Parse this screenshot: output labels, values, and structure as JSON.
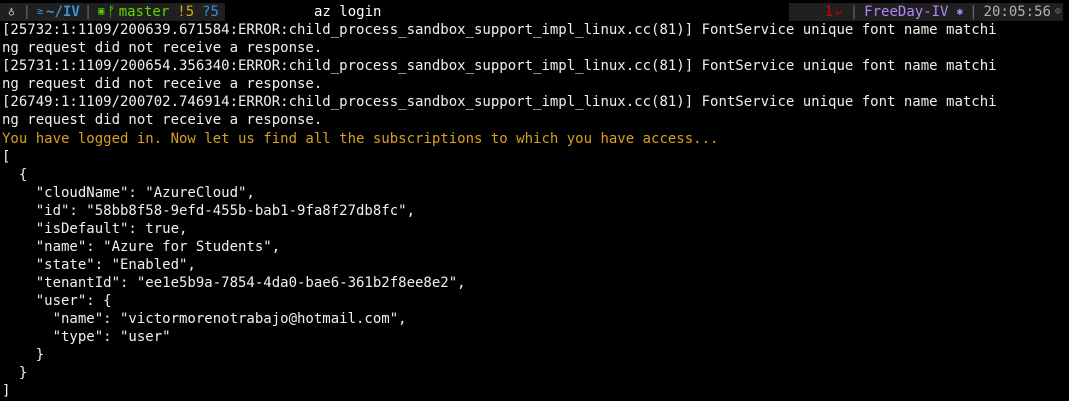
{
  "prompt": {
    "os_icon": "♁",
    "dir_icon": "≥",
    "directory": "~/IV",
    "git_icon": "▣",
    "branch_icon": "ᚠ",
    "branch": "master",
    "modified": "!5",
    "untracked": "?5",
    "command": "az login",
    "exit_code": "1",
    "exit_icon": "↵",
    "env_name": "FreeDay-IV",
    "env_icon": "✱",
    "time": "20:05:56",
    "clock_icon": "⊙",
    "separator": "|"
  },
  "output": {
    "error_lines": [
      "[25732:1:1109/200639.671584:ERROR:child_process_sandbox_support_impl_linux.cc(81)] FontService unique font name matchi",
      "ng request did not receive a response.",
      "[25731:1:1109/200654.356340:ERROR:child_process_sandbox_support_impl_linux.cc(81)] FontService unique font name matchi",
      "ng request did not receive a response.",
      "[26749:1:1109/200702.746914:ERROR:child_process_sandbox_support_impl_linux.cc(81)] FontService unique font name matchi",
      "ng request did not receive a response."
    ],
    "logged_in_message": "You have logged in. Now let us find all the subscriptions to which you have access...",
    "json_lines": [
      "[",
      "  {",
      "    \"cloudName\": \"AzureCloud\",",
      "    \"id\": \"58bb8f58-9efd-455b-bab1-9fa8f27db8fc\",",
      "    \"isDefault\": true,",
      "    \"name\": \"Azure for Students\",",
      "    \"state\": \"Enabled\",",
      "    \"tenantId\": \"ee1e5b9a-7854-4da0-bae6-361b2f8ee8e2\",",
      "    \"user\": {",
      "      \"name\": \"victormorenotrabajo@hotmail.com\",",
      "      \"type\": \"user\"",
      "    }",
      "  }",
      "]"
    ]
  },
  "colors": {
    "background": "#000000",
    "text": "#ffffff",
    "warning": "#d7a020",
    "directory": "#3a8fd8",
    "branch": "#5fd700",
    "modified": "#d7af00",
    "exit_code": "#d70000",
    "env": "#af87ff",
    "prompt_bg": "#202020"
  }
}
